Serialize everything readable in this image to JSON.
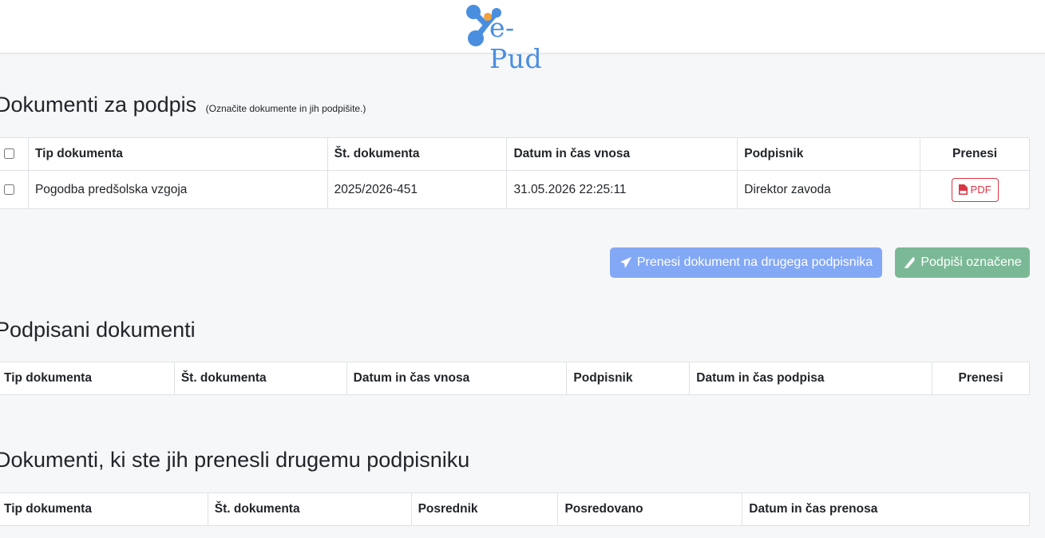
{
  "header": {
    "logo_text": "e-Pud"
  },
  "to_sign": {
    "title": "Dokumenti za podpis",
    "hint": "(Označite dokumente in jih podpišite.)",
    "columns": [
      "Tip dokumenta",
      "Št. dokumenta",
      "Datum in čas vnosa",
      "Podpisnik",
      "Prenesi"
    ],
    "rows": [
      {
        "type": "Pogodba predšolska vzgoja",
        "number": "2025/2026-451",
        "entered": "31.05.2026 22:25:11",
        "signer": "Direktor zavoda",
        "download": "PDF"
      }
    ],
    "transfer_button": "Prenesi dokument na drugega podpisnika",
    "sign_button": "Podpiši označene"
  },
  "signed": {
    "title": "Podpisani dokumenti",
    "columns": [
      "Tip dokumenta",
      "Št. dokumenta",
      "Datum in čas vnosa",
      "Podpisnik",
      "Datum in čas podpisa",
      "Prenesi"
    ]
  },
  "transferred": {
    "title": "Dokumenti, ki ste jih prenesli drugemu podpisniku",
    "columns": [
      "Tip dokumenta",
      "Št. dokumenta",
      "Posrednik",
      "Posredovano",
      "Datum in čas prenosa"
    ]
  },
  "colors": {
    "primary": "#83a8f5",
    "success": "#7bb996",
    "danger": "#dc3545",
    "logo": "#4a8ee0",
    "logo_dot": "#f2a23a"
  }
}
